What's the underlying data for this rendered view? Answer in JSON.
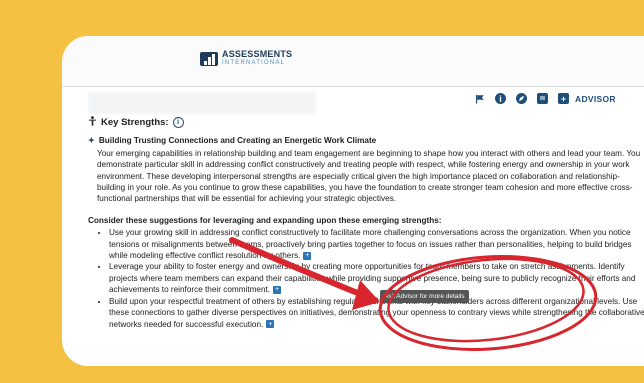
{
  "colors": {
    "frame": "#F5C142",
    "accent": "#1f4e79",
    "annotation": "#d7262e"
  },
  "logo": {
    "line1": "ASSESSMENTS",
    "line2": "INTERNATIONAL"
  },
  "toolbar": {
    "icons": [
      "flag-icon",
      "info-icon",
      "edit-icon",
      "list-icon",
      "advisor-plus-icon"
    ],
    "advisor_label": "ADVISOR"
  },
  "section": {
    "title": "Key Strengths:",
    "strength_title": "Building Trusting Connections and Creating an Energetic Work Climate",
    "paragraph": "Your emerging capabilities in relationship building and team engagement are beginning to shape how you interact with others and lead your team. You demonstrate particular skill in addressing conflict constructively and treating people with respect, while fostering energy and ownership in your work environment. These developing interpersonal strengths are especially critical given the high importance placed on collaboration and relationship-building in your role. As you continue to grow these capabilities, you have the foundation to create stronger team cohesion and more effective cross-functional partnerships that will be essential for achieving your strategic objectives.",
    "consider_heading": "Consider these suggestions for leveraging and expanding upon these emerging strengths:",
    "suggestions": [
      "Use your growing skill in addressing conflict constructively to facilitate more challenging conversations across the organization. When you notice tensions or misalignments between teams, proactively bring parties together to focus on issues rather than personalities, helping to build bridges while modeling effective conflict resolution for others.",
      "Leverage your ability to foster energy and ownership by creating more opportunities for team members to take on stretch assignments. Identify projects where team members can expand their capabilities while providing supportive presence, being sure to publicly recognize their efforts and achievements to reinforce their commitment.",
      "Build upon your respectful treatment of others by establishing regular touchpoints with key stakeholders across different organizational levels. Use these connections to gather diverse perspectives on initiatives, demonstrating your openness to contrary views while strengthening the collaborative networks needed for successful execution."
    ]
  },
  "tooltip": "Ask Advisor for more details"
}
